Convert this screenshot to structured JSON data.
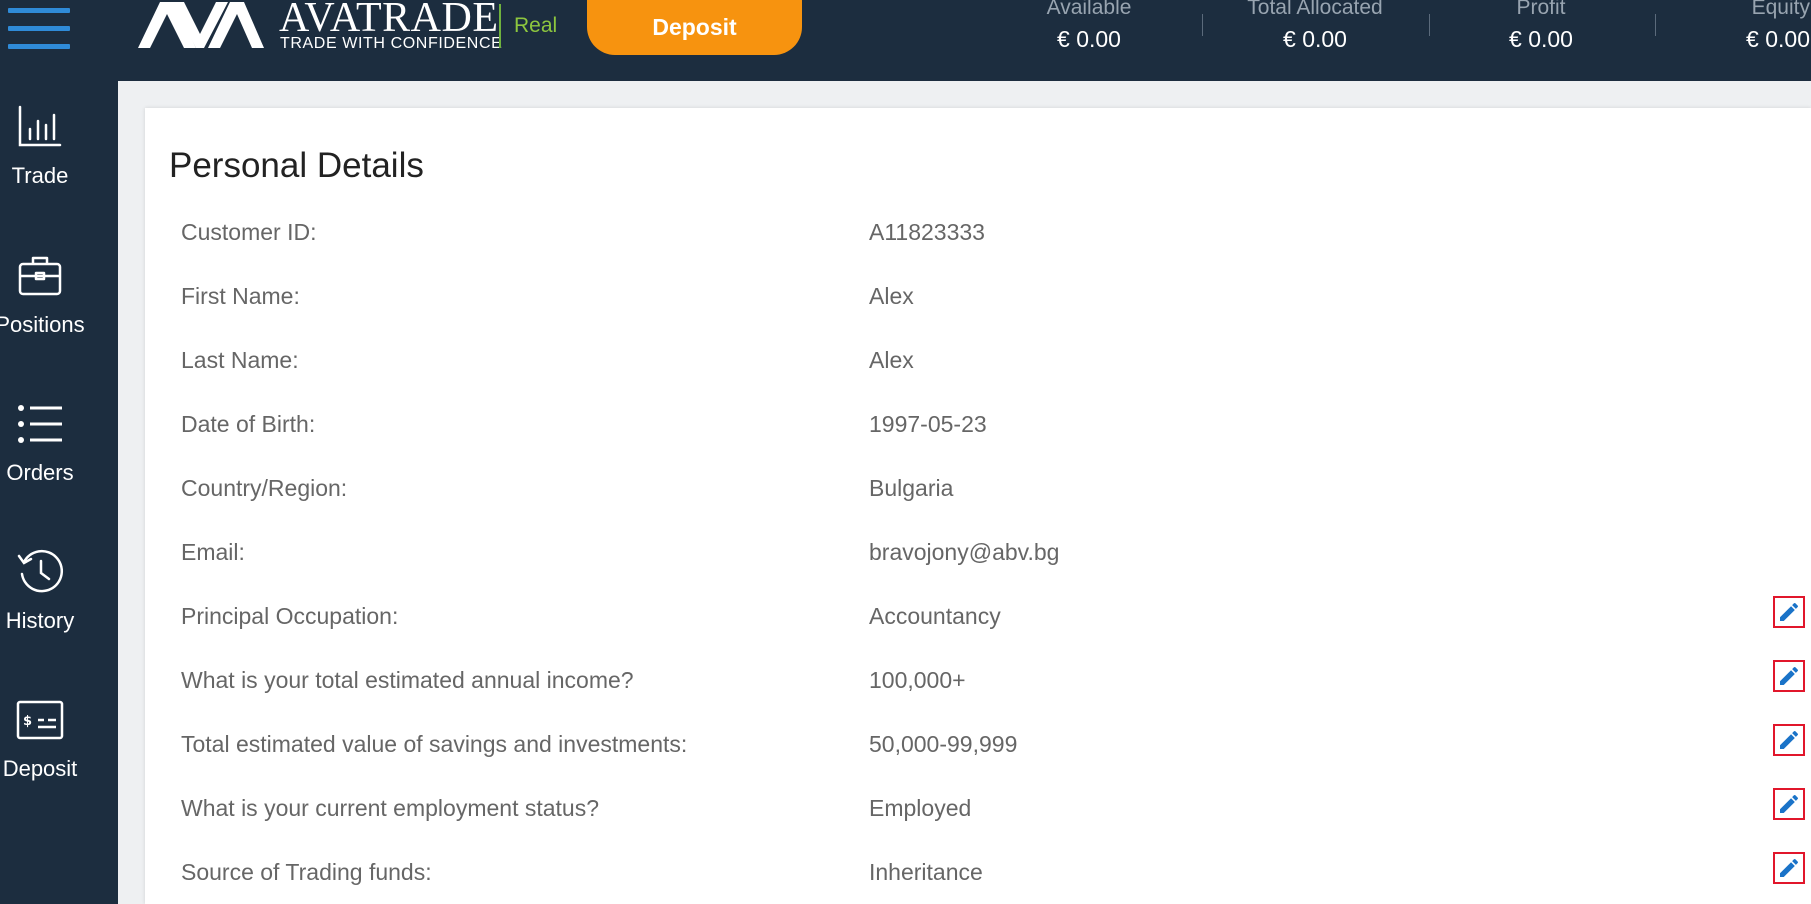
{
  "header": {
    "brand_name": "AVATRADE",
    "brand_tagline": "TRADE WITH CONFIDENCE",
    "account_type": "Real",
    "deposit_label": "Deposit",
    "stats": [
      {
        "label": "Available",
        "value": "€ 0.00"
      },
      {
        "label": "Total Allocated",
        "value": "€ 0.00"
      },
      {
        "label": "Profit",
        "value": "€ 0.00"
      },
      {
        "label": "Equity",
        "value": "€ 0.00"
      }
    ]
  },
  "sidebar": {
    "items": [
      {
        "label": "Trade",
        "icon": "bar-chart-icon"
      },
      {
        "label": "Positions",
        "icon": "briefcase-icon"
      },
      {
        "label": "Orders",
        "icon": "list-icon"
      },
      {
        "label": "History",
        "icon": "history-icon"
      },
      {
        "label": "Deposit",
        "icon": "deposit-card-icon"
      }
    ]
  },
  "main": {
    "title": "Personal Details",
    "rows": [
      {
        "label": "Customer ID:",
        "value": "A11823333",
        "editable": false
      },
      {
        "label": "First Name:",
        "value": "Alex",
        "editable": false
      },
      {
        "label": "Last Name:",
        "value": "Alex",
        "editable": false
      },
      {
        "label": "Date of Birth:",
        "value": "1997-05-23",
        "editable": false
      },
      {
        "label": "Country/Region:",
        "value": "Bulgaria",
        "editable": false
      },
      {
        "label": "Email:",
        "value": "bravojony@abv.bg",
        "editable": false
      },
      {
        "label": "Principal Occupation:",
        "value": "Accountancy",
        "editable": true
      },
      {
        "label": "What is your total estimated annual income?",
        "value": "100,000+",
        "editable": true
      },
      {
        "label": "Total estimated value of savings and investments:",
        "value": "50,000-99,999",
        "editable": true
      },
      {
        "label": "What is your current employment status?",
        "value": "Employed",
        "editable": true
      },
      {
        "label": "Source of Trading funds:",
        "value": "Inheritance",
        "editable": true
      }
    ]
  },
  "colors": {
    "header_bg": "#1c2d3f",
    "accent_blue": "#2f8bd8",
    "deposit_orange": "#f7930f",
    "real_green": "#8dc63f",
    "edit_border_red": "#e1162b"
  }
}
